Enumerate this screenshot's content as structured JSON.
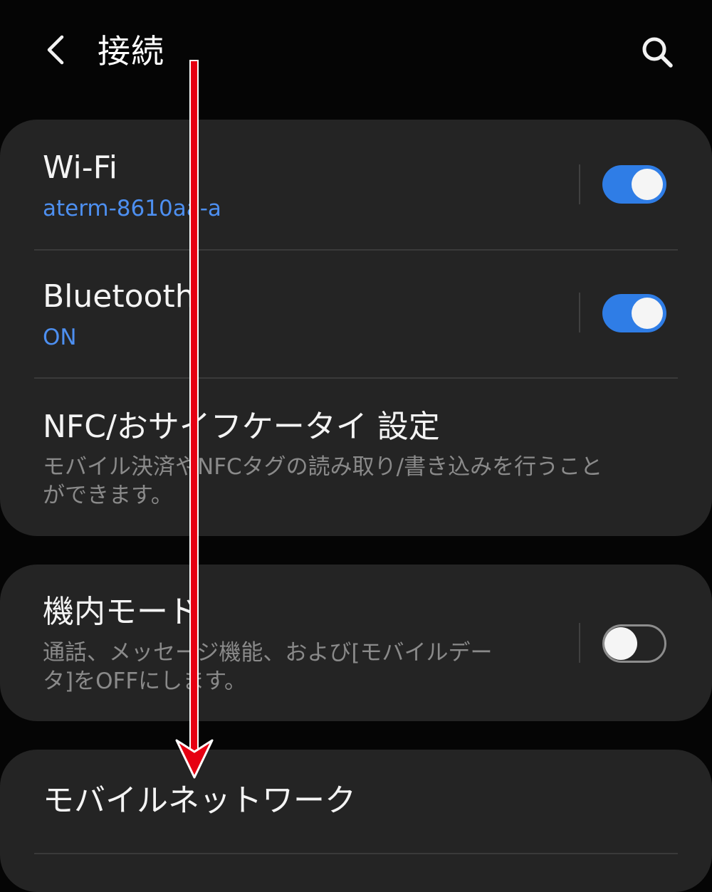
{
  "header": {
    "title": "接続",
    "back_icon": "chevron-left-icon",
    "search_icon": "search-icon"
  },
  "connections": {
    "wifi": {
      "title": "Wi-Fi",
      "status": "aterm-8610aa-a",
      "enabled": true
    },
    "bluetooth": {
      "title": "Bluetooth",
      "status": "ON",
      "enabled": true
    },
    "nfc": {
      "title": "NFC/おサイフケータイ 設定",
      "description_line1": "モバイル決済やNFCタグの読み取り/書き込みを行うこと",
      "description_line2": "ができます。"
    }
  },
  "airplane": {
    "title": "機内モード",
    "description_line1": "通話、メッセージ機能、および[モバイルデー",
    "description_line2": "タ]をOFFにします。",
    "enabled": false
  },
  "mobile_network": {
    "title": "モバイルネットワーク"
  },
  "colors": {
    "background": "#050505",
    "card": "#242424",
    "accent_blue": "#2f7de6",
    "subtext_blue": "#4d8ff0",
    "annotation_red": "#e60012"
  },
  "annotation": {
    "type": "arrow-down"
  }
}
